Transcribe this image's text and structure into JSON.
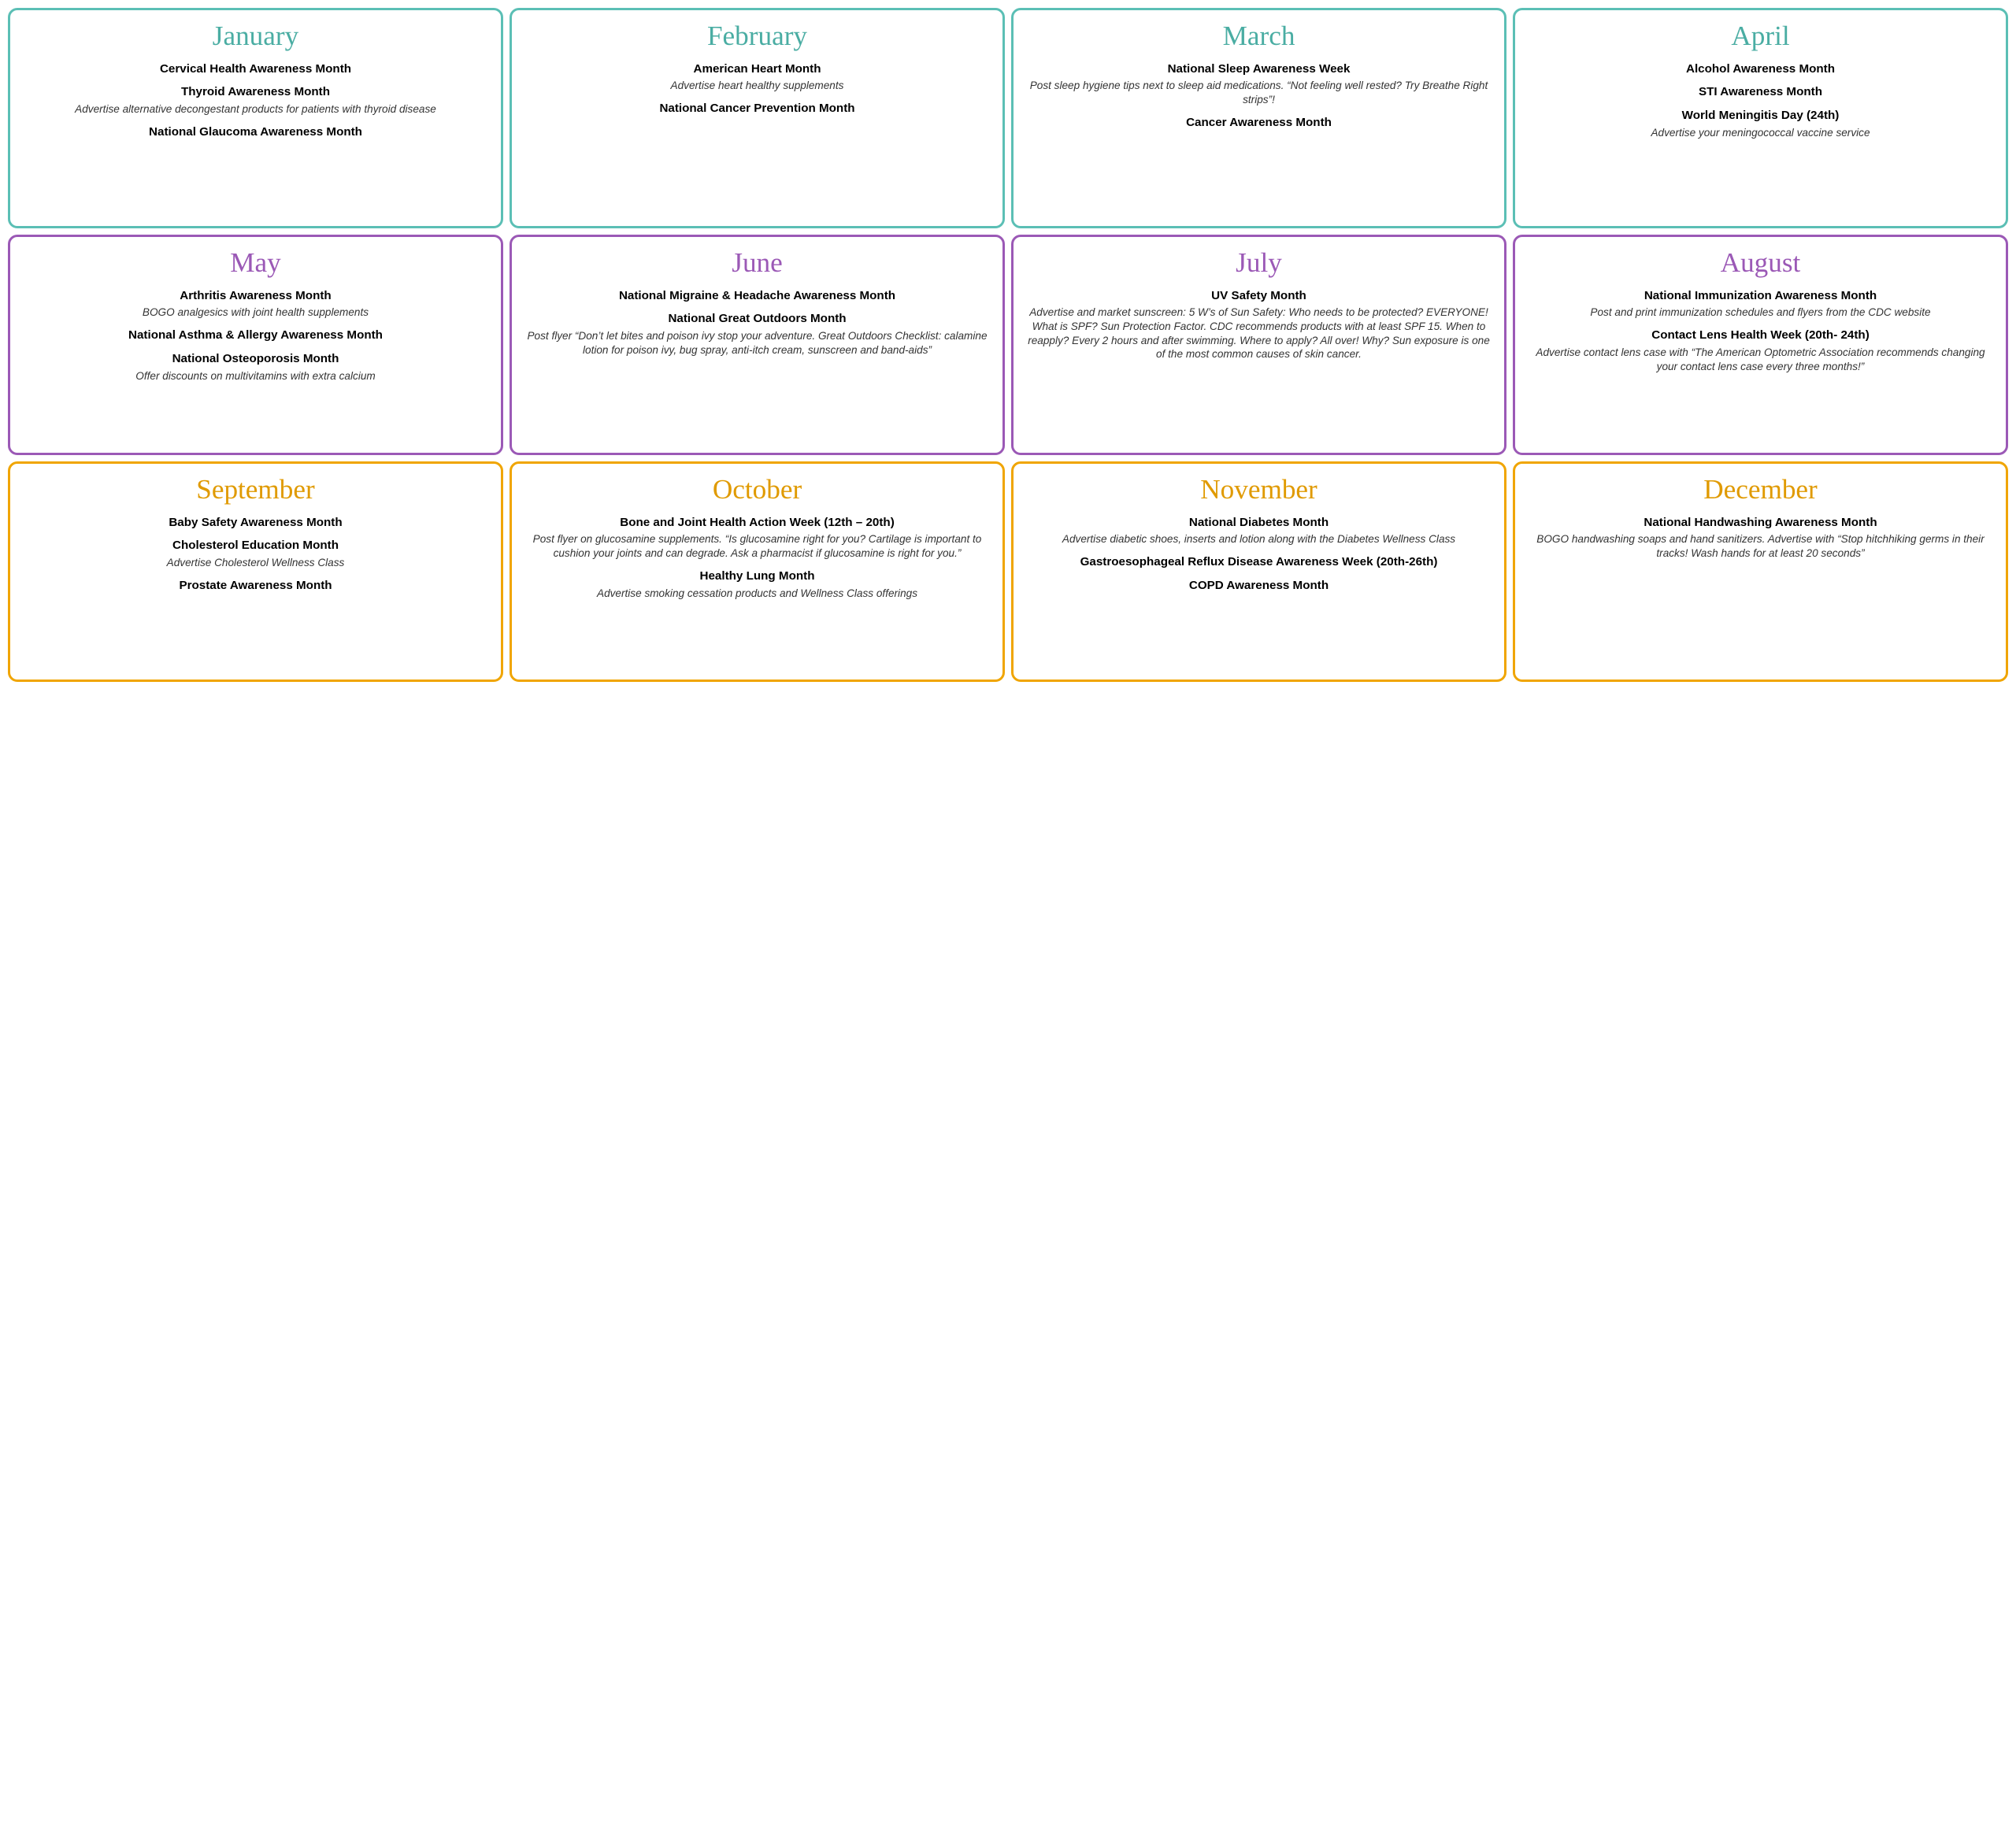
{
  "months": [
    {
      "name": "January",
      "colorClass": "card-teal",
      "titleClass": "teal-title",
      "events": [
        {
          "title": "Cervical Health Awareness Month",
          "desc": ""
        },
        {
          "title": "Thyroid Awareness Month",
          "desc": "Advertise alternative decongestant products for patients with thyroid disease"
        },
        {
          "title": "National Glaucoma Awareness Month",
          "desc": ""
        }
      ]
    },
    {
      "name": "February",
      "colorClass": "card-teal",
      "titleClass": "teal-title",
      "events": [
        {
          "title": "American Heart Month",
          "desc": "Advertise heart healthy supplements"
        },
        {
          "title": "National Cancer Prevention Month",
          "desc": ""
        }
      ]
    },
    {
      "name": "March",
      "colorClass": "card-teal",
      "titleClass": "teal-title",
      "events": [
        {
          "title": "National Sleep Awareness Week",
          "desc": "Post sleep hygiene tips next to sleep aid medications. “Not feeling well rested? Try Breathe Right strips”!"
        },
        {
          "title": "Cancer Awareness Month",
          "desc": ""
        }
      ]
    },
    {
      "name": "April",
      "colorClass": "card-teal",
      "titleClass": "teal-title",
      "events": [
        {
          "title": "Alcohol Awareness Month",
          "desc": ""
        },
        {
          "title": "STI Awareness Month",
          "desc": ""
        },
        {
          "title": "World Meningitis Day (24th)",
          "desc": "Advertise your meningococcal vaccine service"
        }
      ]
    },
    {
      "name": "May",
      "colorClass": "card-purple",
      "titleClass": "purple-title",
      "events": [
        {
          "title": "Arthritis Awareness Month",
          "desc": "BOGO analgesics with joint health supplements"
        },
        {
          "title": "National Asthma & Allergy Awareness Month",
          "desc": ""
        },
        {
          "title": "National Osteoporosis Month",
          "desc": "Offer discounts on multivitamins with extra calcium"
        }
      ]
    },
    {
      "name": "June",
      "colorClass": "card-purple",
      "titleClass": "purple-title",
      "events": [
        {
          "title": "National Migraine & Headache Awareness Month",
          "desc": ""
        },
        {
          "title": "National Great Outdoors Month",
          "desc": "Post flyer “Don’t let bites and poison ivy stop your adventure. Great Outdoors Checklist: calamine lotion for poison ivy, bug spray, anti-itch cream, sunscreen and band-aids”"
        }
      ]
    },
    {
      "name": "July",
      "colorClass": "card-purple",
      "titleClass": "purple-title",
      "events": [
        {
          "title": "UV Safety Month",
          "desc": "Advertise and market sunscreen: 5 W’s of Sun Safety: Who needs to be protected? EVERYONE! What is SPF? Sun Protection Factor. CDC recommends products with at least SPF 15. When to reapply? Every 2 hours and after swimming. Where to apply? All over! Why? Sun exposure is one of the most common causes of skin cancer."
        }
      ]
    },
    {
      "name": "August",
      "colorClass": "card-purple",
      "titleClass": "purple-title",
      "events": [
        {
          "title": "National Immunization Awareness Month",
          "desc": "Post and print immunization schedules and flyers from the CDC website"
        },
        {
          "title": "Contact Lens Health Week (20th- 24th)",
          "desc": "Advertise contact lens case with “The American Optometric Association recommends changing your contact lens case every three months!”"
        }
      ]
    },
    {
      "name": "September",
      "colorClass": "card-orange",
      "titleClass": "orange-title",
      "events": [
        {
          "title": "Baby Safety Awareness Month",
          "desc": ""
        },
        {
          "title": "Cholesterol Education Month",
          "desc": "Advertise Cholesterol Wellness Class"
        },
        {
          "title": "Prostate Awareness Month",
          "desc": ""
        }
      ]
    },
    {
      "name": "October",
      "colorClass": "card-orange",
      "titleClass": "orange-title",
      "events": [
        {
          "title": "Bone and Joint Health Action Week (12th – 20th)",
          "desc": "Post flyer on glucosamine supplements. “Is glucosamine right for you? Cartilage is important to cushion your joints and can degrade. Ask a pharmacist if glucosamine is right for you.”"
        },
        {
          "title": "Healthy Lung Month",
          "desc": "Advertise smoking cessation products and Wellness Class offerings"
        }
      ]
    },
    {
      "name": "November",
      "colorClass": "card-orange",
      "titleClass": "orange-title",
      "events": [
        {
          "title": "National Diabetes Month",
          "desc": "Advertise diabetic shoes, inserts and lotion along with the Diabetes Wellness Class"
        },
        {
          "title": "Gastroesophageal Reflux Disease Awareness Week (20th-26th)",
          "desc": ""
        },
        {
          "title": "COPD Awareness Month",
          "desc": ""
        }
      ]
    },
    {
      "name": "December",
      "colorClass": "card-orange",
      "titleClass": "orange-title",
      "events": [
        {
          "title": "National Handwashing Awareness Month",
          "desc": "BOGO handwashing soaps and hand sanitizers. Advertise with “Stop hitchhiking germs in their tracks! Wash hands for at least 20 seconds”"
        }
      ]
    }
  ]
}
